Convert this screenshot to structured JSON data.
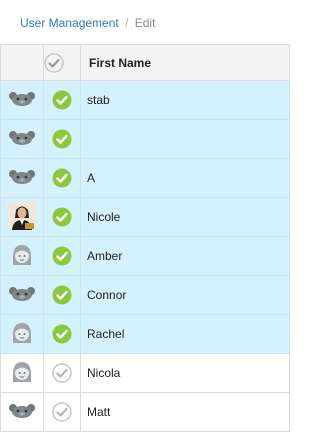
{
  "breadcrumb": {
    "link": "User Management",
    "separator": "/",
    "current": "Edit"
  },
  "table": {
    "header": {
      "select_all_icon": "check-circle-grey",
      "first_name": "First Name"
    },
    "rows": [
      {
        "avatar": "bear-icon",
        "checked": true,
        "first_name": "stab",
        "selected": true
      },
      {
        "avatar": "bear-icon",
        "checked": true,
        "first_name": "",
        "selected": true
      },
      {
        "avatar": "bear-icon",
        "checked": true,
        "first_name": "A",
        "selected": true
      },
      {
        "avatar": "photo-avatar",
        "checked": true,
        "first_name": "Nicole",
        "selected": true
      },
      {
        "avatar": "girl-icon",
        "checked": true,
        "first_name": "Amber",
        "selected": true
      },
      {
        "avatar": "bear-icon",
        "checked": true,
        "first_name": "Connor",
        "selected": true
      },
      {
        "avatar": "girl-icon",
        "checked": true,
        "first_name": "Rachel",
        "selected": true
      },
      {
        "avatar": "girl-icon",
        "checked": false,
        "first_name": "Nicola",
        "selected": false
      },
      {
        "avatar": "bear-icon",
        "checked": false,
        "first_name": "Matt",
        "selected": false
      }
    ]
  },
  "colors": {
    "link": "#337ab7",
    "selected_row": "#d5f1fb",
    "check_on": "#8dc63f",
    "check_off": "#c6c6c6"
  }
}
